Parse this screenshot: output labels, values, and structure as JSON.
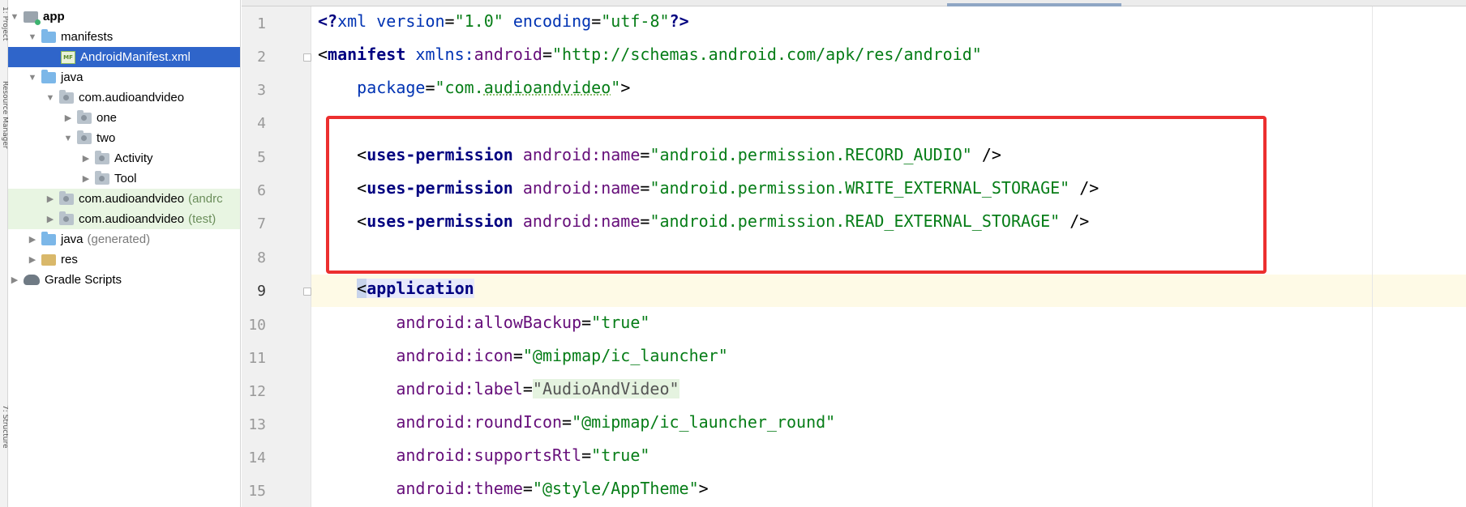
{
  "tool_strip": {
    "top_label": "1: Project",
    "middle_label": "Resource Manager",
    "bottom_label": "7: Structure"
  },
  "tree": {
    "items": [
      {
        "label": "app",
        "suffix": "",
        "icon": "app-module-icon",
        "expanded": true
      },
      {
        "label": "manifests",
        "suffix": "",
        "icon": "folder-icon",
        "expanded": true
      },
      {
        "label": "AndroidManifest.xml",
        "suffix": "",
        "icon": "manifest-file-icon",
        "selected": true
      },
      {
        "label": "java",
        "suffix": "",
        "icon": "folder-icon",
        "expanded": true
      },
      {
        "label": "com.audioandvideo",
        "suffix": "",
        "icon": "package-icon",
        "expanded": true
      },
      {
        "label": "one",
        "suffix": "",
        "icon": "package-icon",
        "expanded": false
      },
      {
        "label": "two",
        "suffix": "",
        "icon": "package-icon",
        "expanded": true
      },
      {
        "label": "Activity",
        "suffix": "",
        "icon": "package-icon",
        "expanded": false
      },
      {
        "label": "Tool",
        "suffix": "",
        "icon": "package-icon",
        "expanded": false
      },
      {
        "label": "com.audioandvideo",
        "suffix": "(andrc",
        "icon": "package-icon",
        "expanded": false
      },
      {
        "label": "com.audioandvideo",
        "suffix": "(test)",
        "icon": "package-icon",
        "expanded": false
      },
      {
        "label": "java",
        "suffix": "(generated)",
        "icon": "generated-folder-icon",
        "expanded": false
      },
      {
        "label": "res",
        "suffix": "",
        "icon": "res-folder-icon",
        "expanded": false
      },
      {
        "label": "Gradle Scripts",
        "suffix": "",
        "icon": "gradle-icon",
        "expanded": false
      }
    ],
    "xml_badge": "MF"
  },
  "editor": {
    "line_numbers": [
      "1",
      "2",
      "3",
      "4",
      "5",
      "6",
      "7",
      "8",
      "9",
      "10",
      "11",
      "12",
      "13",
      "14",
      "15"
    ],
    "current_line": "9",
    "code": {
      "l1": {
        "a": "<?",
        "b": "xml version",
        "c": "=",
        "d": "\"1.0\"",
        "e": " encoding",
        "f": "=",
        "g": "\"utf-8\"",
        "h": "?>"
      },
      "l2": {
        "a": "<",
        "b": "manifest",
        "c": " xmlns:",
        "d": "android",
        "e": "=",
        "f": "\"http://schemas.android.com/apk/res/android\""
      },
      "l3": {
        "indent": "    ",
        "a": "package",
        "b": "=",
        "c": "\"com.",
        "d": "audioandvideo",
        "e": "\"",
        "f": ">"
      },
      "l5": {
        "indent": "    ",
        "a": "<",
        "b": "uses-permission",
        "c": " android:",
        "d": "name",
        "e": "=",
        "f": "\"android.permission.RECORD_AUDIO\"",
        "g": " />"
      },
      "l6": {
        "indent": "    ",
        "a": "<",
        "b": "uses-permission",
        "c": " android:",
        "d": "name",
        "e": "=",
        "f": "\"android.permission.WRITE_EXTERNAL_STORAGE\"",
        "g": " />"
      },
      "l7": {
        "indent": "    ",
        "a": "<",
        "b": "uses-permission",
        "c": " android:",
        "d": "name",
        "e": "=",
        "f": "\"android.permission.READ_EXTERNAL_STORAGE\"",
        "g": " />"
      },
      "l9": {
        "indent": "    ",
        "a": "<",
        "b": "application"
      },
      "l10": {
        "indent": "        ",
        "a": "android:",
        "b": "allowBackup",
        "c": "=",
        "d": "\"true\""
      },
      "l11": {
        "indent": "        ",
        "a": "android:",
        "b": "icon",
        "c": "=",
        "d": "\"@mipmap/ic_launcher\""
      },
      "l12": {
        "indent": "        ",
        "a": "android:",
        "b": "label",
        "c": "=",
        "d": "\"AudioAndVideo\""
      },
      "l13": {
        "indent": "        ",
        "a": "android:",
        "b": "roundIcon",
        "c": "=",
        "d": "\"@mipmap/ic_launcher_round\""
      },
      "l14": {
        "indent": "        ",
        "a": "android:",
        "b": "supportsRtl",
        "c": "=",
        "d": "\"true\""
      },
      "l15": {
        "indent": "        ",
        "a": "android:",
        "b": "theme",
        "c": "=",
        "d": "\"@style/AppTheme\"",
        "e": ">"
      }
    }
  },
  "colors": {
    "tag": "#000080",
    "attribute": "#660e7a",
    "value": "#067d17",
    "selection": "#2f65ca",
    "annotation_box": "#ec2f2f",
    "current_line": "#fefae6"
  }
}
